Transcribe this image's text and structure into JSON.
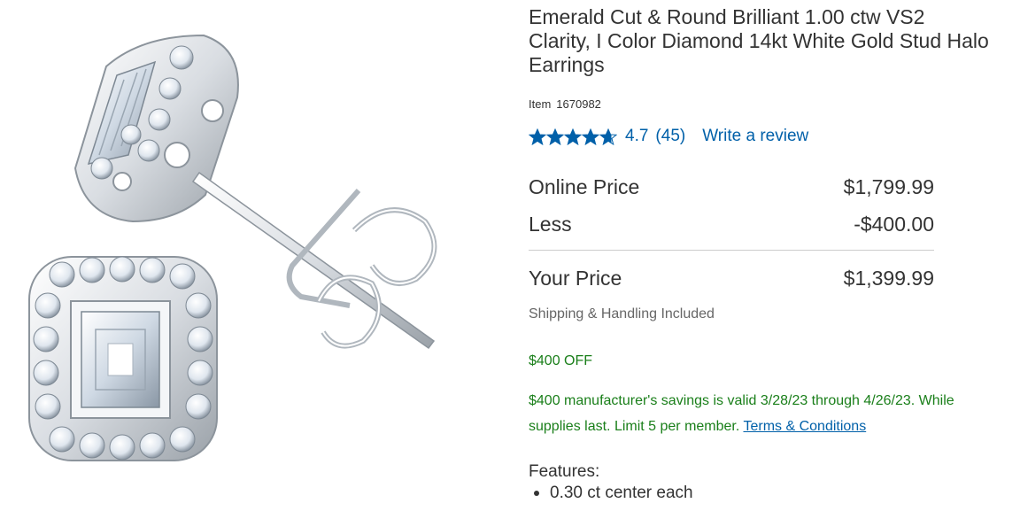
{
  "product": {
    "title": "Emerald Cut & Round Brilliant 1.00 ctw VS2 Clarity, I Color Diamond 14kt White Gold Stud Halo Earrings",
    "item_label": "Item",
    "item_number": "1670982",
    "image_alt": "Emerald cut diamond halo stud earrings in white gold"
  },
  "rating": {
    "stars": 4.7,
    "value": "4.7",
    "count": "(45)",
    "write_review": "Write a review",
    "star_color": "#0060a9"
  },
  "pricing": {
    "online_label": "Online Price",
    "online_value": "$1,799.99",
    "less_label": "Less",
    "less_value": "-$400.00",
    "your_label": "Your Price",
    "your_value": "$1,399.99",
    "shipping": "Shipping & Handling Included"
  },
  "promo": {
    "off": "$400 OFF",
    "savings_text": "$400 manufacturer's savings is valid 3/28/23 through 4/26/23. While supplies last. Limit 5 per member.",
    "terms_link": "Terms & Conditions",
    "color": "#1a7f1a"
  },
  "features": {
    "label": "Features:",
    "items": [
      "0.30 ct center each"
    ]
  }
}
